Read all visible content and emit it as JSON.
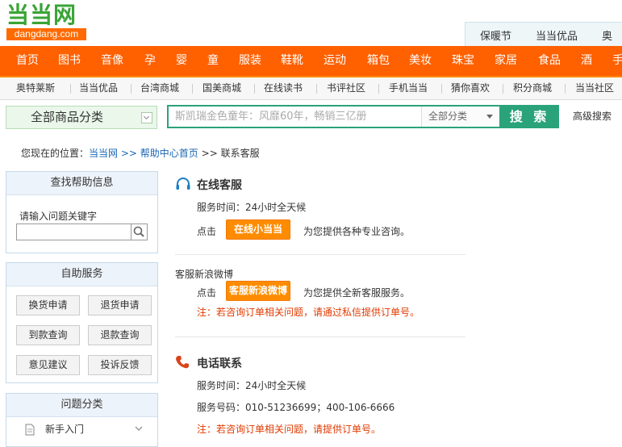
{
  "logo": {
    "cn": "当当网",
    "en": "dangdang.com"
  },
  "top_tabs": [
    "保暖节",
    "当当优品",
    "奥"
  ],
  "main_nav": [
    "首页",
    "图书",
    "音像",
    "孕",
    "婴",
    "童",
    "服装",
    "鞋靴",
    "运动",
    "箱包",
    "美妆",
    "珠宝",
    "家居",
    "食品",
    "酒",
    "手"
  ],
  "sub_nav": [
    "奥特莱斯",
    "当当优品",
    "台湾商城",
    "国美商城",
    "在线读书",
    "书评社区",
    "手机当当",
    "猜你喜欢",
    "积分商城",
    "当当社区"
  ],
  "search": {
    "category_label": "全部商品分类",
    "placeholder": "斯凯瑞金色童年：风靡60年，畅销三亿册",
    "scope": "全部分类",
    "button": "搜 索",
    "advanced": "高级搜索"
  },
  "breadcrumb": {
    "prefix": "您现在的位置：",
    "items": [
      "当当网",
      "帮助中心首页",
      "联系客服"
    ],
    "separator": ">>"
  },
  "sidebar": {
    "find_help": {
      "title": "查找帮助信息",
      "label": "请输入问题关键字"
    },
    "self_service": {
      "title": "自助服务",
      "buttons": [
        "换货申请",
        "退货申请",
        "到款查询",
        "退款查询",
        "意见建议",
        "投诉反馈"
      ]
    },
    "categories": {
      "title": "问题分类",
      "items": [
        "新手入门"
      ]
    }
  },
  "online": {
    "title": "在线客服",
    "hours": "服务时间：24小时全天候",
    "click": "点击",
    "button": "在线小当当",
    "desc": "为您提供各种专业咨询。"
  },
  "weibo": {
    "title": "客服新浪微博",
    "click": "点击",
    "button": "客服新浪微博",
    "desc": "为您提供全新客服服务。",
    "note": "注：若咨询订单相关问题，请通过私信提供订单号。"
  },
  "phone": {
    "title": "电话联系",
    "hours": "服务时间：24小时全天候",
    "numbers": "服务号码：010-51236699；400-106-6666",
    "note": "注：若咨询订单相关问题，请提供订单号。"
  },
  "colors": {
    "nav_orange": "#ff6000",
    "brand_green": "#2aa37b",
    "link_blue": "#1a66b3",
    "note_red": "#e03a00"
  }
}
